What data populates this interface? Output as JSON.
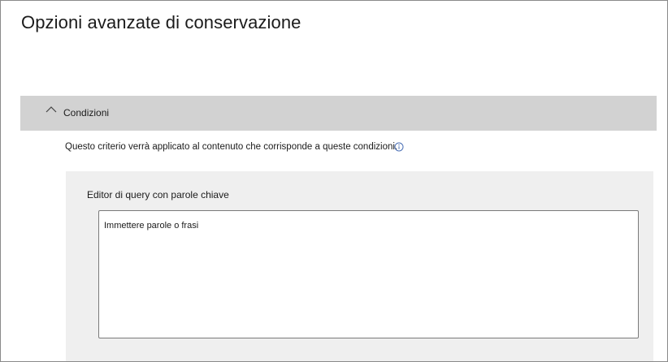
{
  "page": {
    "title": "Opzioni avanzate di conservazione"
  },
  "conditions": {
    "label": "Condizioni",
    "expanded": true,
    "description": "Questo criterio verrà applicato al contenuto che corrisponde a queste condizioni."
  },
  "keyword_editor": {
    "label": "Editor di query con parole chiave",
    "placeholder": "Immettere parole o frasi",
    "value": ""
  },
  "colors": {
    "section_header_bg": "#d2d2d2",
    "panel_bg": "#efefef",
    "info_icon": "#4a6fb5"
  },
  "icons": {
    "toggle": "chevron-up-icon",
    "info": "info-icon"
  }
}
